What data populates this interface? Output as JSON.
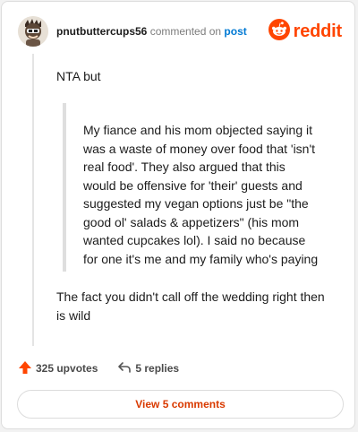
{
  "header": {
    "username": "pnutbuttercups56",
    "action": "commented on",
    "link": "post",
    "brand": "reddit"
  },
  "comment": {
    "intro": "NTA but",
    "quote_lines": [
      "My fiance and his mom objected saying it",
      "was a waste of money over food that 'isn't",
      "real food'. They also argued that this",
      "would be offensive for 'their' guests and",
      "suggested my vegan options just be \"the",
      "good ol' salads & appetizers\" (his mom",
      "wanted cupcakes lol). I said no because",
      "for one it's me and my family who's paying"
    ],
    "after_lines": [
      "The fact you didn't call off the wedding right then",
      "is wild"
    ]
  },
  "actions": {
    "upvotes": "325 upvotes",
    "replies": "5 replies"
  },
  "view_button": "View 5 comments",
  "colors": {
    "brand": "#ff4500",
    "link": "#0079d3",
    "view": "#d93a00"
  },
  "icons": [
    "avatar",
    "reddit-logo-icon",
    "upvote-arrow-icon",
    "reply-arrow-icon"
  ]
}
